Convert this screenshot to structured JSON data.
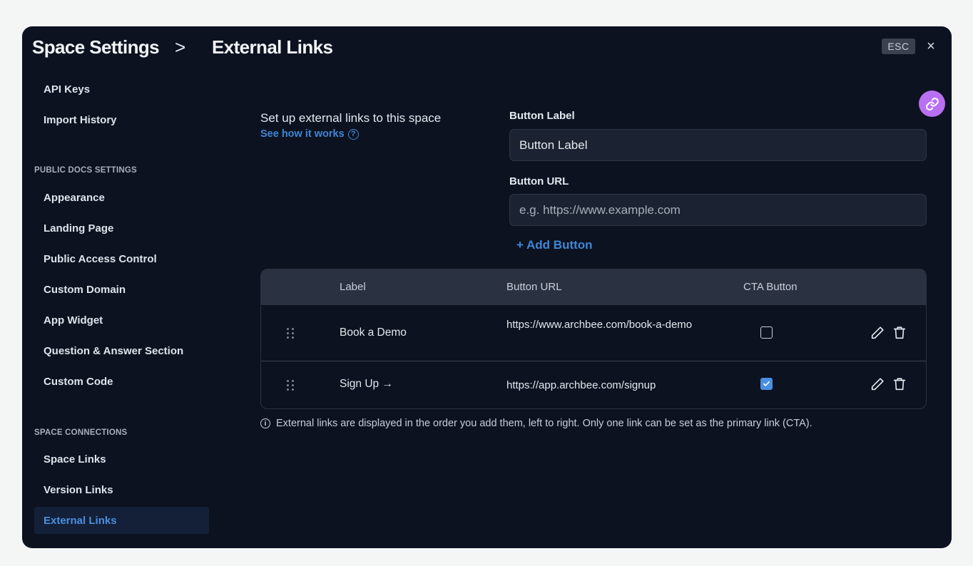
{
  "header": {
    "title": "Space Settings",
    "separator": ">",
    "current": "External Links",
    "esc_label": "ESC",
    "close_label": "×"
  },
  "sidebar": {
    "items_top": [
      {
        "label": "API Keys"
      },
      {
        "label": "Import History"
      }
    ],
    "sections": [
      {
        "title": "PUBLIC DOCS SETTINGS",
        "items": [
          {
            "label": "Appearance"
          },
          {
            "label": "Landing Page"
          },
          {
            "label": "Public Access Control"
          },
          {
            "label": "Custom Domain"
          },
          {
            "label": "App Widget"
          },
          {
            "label": "Question & Answer Section"
          },
          {
            "label": "Custom Code"
          }
        ]
      },
      {
        "title": "SPACE CONNECTIONS",
        "items": [
          {
            "label": "Space Links"
          },
          {
            "label": "Version Links"
          },
          {
            "label": "External Links",
            "active": true
          }
        ]
      }
    ]
  },
  "intro": {
    "title": "Set up external links to this space",
    "link": "See how it works",
    "help_glyph": "?"
  },
  "form": {
    "label_field": {
      "label": "Button Label",
      "value": "Button Label"
    },
    "url_field": {
      "label": "Button URL",
      "placeholder": "e.g. https://www.example.com",
      "value": ""
    },
    "add_button": "+ Add Button"
  },
  "table": {
    "columns": [
      "Label",
      "Button URL",
      "CTA Button"
    ],
    "rows": [
      {
        "label": "Book a Demo",
        "url": "https://www.archbee.com/book-a-demo",
        "cta": false
      },
      {
        "label": "Sign Up →",
        "url": "https://app.archbee.com/signup",
        "cta": true
      }
    ]
  },
  "note": {
    "icon_glyph": "i",
    "text": "External links are displayed in the order you add them, left to right. Only one link can be set as the primary link (CTA)."
  },
  "colors": {
    "background": "#0c1220",
    "accent": "#3f86d6",
    "fab": "#b96ff2",
    "active_nav_bg": "#142038"
  }
}
